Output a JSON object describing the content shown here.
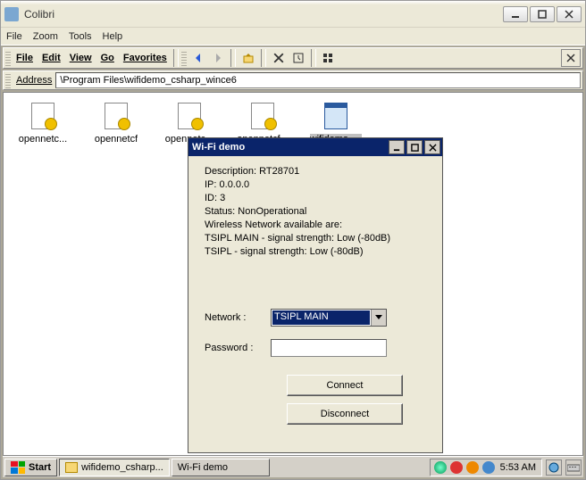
{
  "outer": {
    "title": "Colibri"
  },
  "outer_menu": {
    "file": "File",
    "zoom": "Zoom",
    "tools": "Tools",
    "help": "Help"
  },
  "inner_menu": {
    "file": "File",
    "edit": "Edit",
    "view": "View",
    "go": "Go",
    "favorites": "Favorites"
  },
  "address": {
    "label": "Address",
    "value": "\\Program Files\\wifidemo_csharp_wince6"
  },
  "files": [
    {
      "name": "opennetc..."
    },
    {
      "name": "opennetcf"
    },
    {
      "name": "opennetc..."
    },
    {
      "name": "opennetcf..."
    },
    {
      "name": "wifidemo_...",
      "selected": true,
      "app": true
    }
  ],
  "dialog": {
    "title": "Wi-Fi demo",
    "status": {
      "desc_label": "Description: ",
      "desc": "RT28701",
      "ip_label": "IP: ",
      "ip": "0.0.0.0",
      "id_label": "ID: ",
      "id": "3",
      "status_label": "Status: ",
      "status": "NonOperational",
      "avail": "Wireless Network available are:",
      "net1": "TSIPL MAIN -  signal strength: Low (-80dB)",
      "net2": "TSIPL -  signal strength: Low (-80dB)"
    },
    "network_label": "Network  :",
    "network_value": "TSIPL MAIN",
    "password_label": "Password  :",
    "connect": "Connect",
    "disconnect": "Disconnect"
  },
  "taskbar": {
    "start": "Start",
    "task1": "wifidemo_csharp...",
    "task2": "Wi-Fi demo",
    "clock": "5:53 AM"
  }
}
